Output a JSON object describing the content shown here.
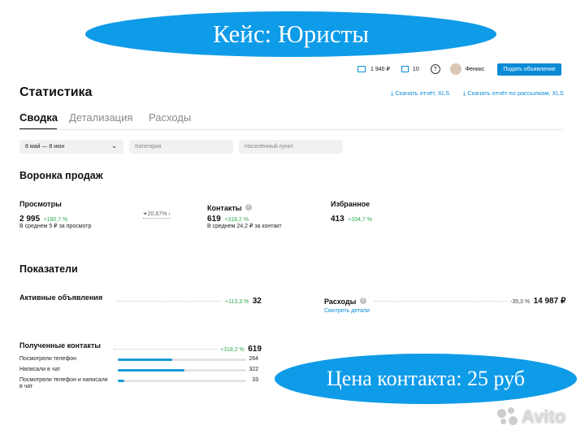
{
  "banner_top": "Кейс: Юристы",
  "banner_bottom": "Цена контакта: 25 руб",
  "topbar": {
    "balance": "1 940 ₽",
    "bonus": "10",
    "user": "Феникс",
    "post_ad": "Подать объявление"
  },
  "page_title": "Статистика",
  "downloads": {
    "report": "Скачать отчёт, XLS",
    "mailing_report": "Скачать отчёт по рассылкам, XLS"
  },
  "tabs": [
    {
      "label": "Сводка",
      "active": true
    },
    {
      "label": "Детализация"
    },
    {
      "label": "Расходы"
    }
  ],
  "filters": {
    "date": "8 май — 8 июн",
    "category_placeholder": "Категория",
    "city_placeholder": "Населённый пункт"
  },
  "funnel": {
    "title": "Воронка продаж",
    "views": {
      "label": "Просмотры",
      "value": "2 995",
      "change": "+180,7 %",
      "avg": "В среднем 5 ₽ за просмотр"
    },
    "conversion": "20,67%",
    "contacts": {
      "label": "Контакты",
      "value": "619",
      "change": "+318,2 %",
      "avg": "В среднем 24,2 ₽ за контакт"
    },
    "favorites": {
      "label": "Избранное",
      "value": "413",
      "change": "+334,7 %"
    }
  },
  "indicators": {
    "title": "Показатели",
    "active_ads": {
      "label": "Активные объявления",
      "change": "+113,3 %",
      "value": "32"
    },
    "expenses": {
      "label": "Расходы",
      "change": "-35,3 %",
      "value": "14 987 ₽",
      "link": "Смотреть детали"
    },
    "received": {
      "label": "Полученные контакты",
      "change": "+318,2 %",
      "value": "619",
      "rows": [
        {
          "label": "Посмотрели телефон",
          "value": "264",
          "fraction": 0.426
        },
        {
          "label": "Написали в чат",
          "value": "322",
          "fraction": 0.52
        },
        {
          "label": "Посмотрели телефон и написали в чат",
          "value": "33",
          "fraction": 0.053
        }
      ]
    }
  },
  "watermark": "Avito",
  "colors": {
    "accent": "#0a8bd6",
    "banner": "#0e9be8",
    "positive": "#2fa84f",
    "bar": "#1a9bd7"
  }
}
